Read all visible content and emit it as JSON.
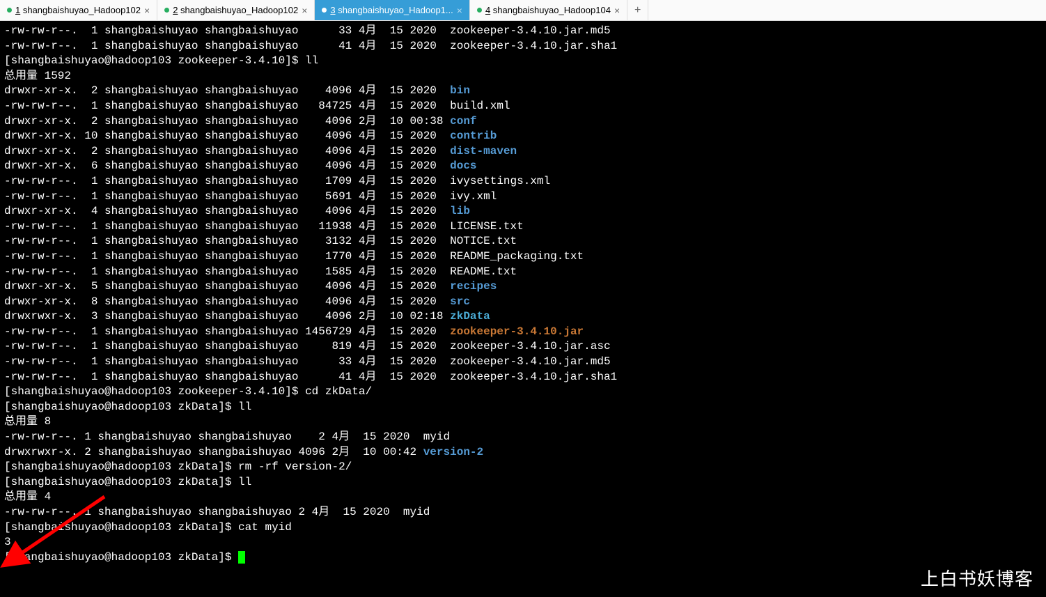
{
  "tabs": [
    {
      "num": "1",
      "label": " shangbaishuyao_Hadoop102",
      "close": "×",
      "active": false
    },
    {
      "num": "2",
      "label": " shangbaishuyao_Hadoop102",
      "close": "×",
      "active": false
    },
    {
      "num": "3",
      "label": " shangbaishuyao_Hadoop1...",
      "close": "×",
      "active": true
    },
    {
      "num": "4",
      "label": " shangbaishuyao_Hadoop104",
      "close": "×",
      "active": false
    }
  ],
  "tab_add": "+",
  "watermark": "上白书妖博客",
  "header_rows": [
    {
      "perm": "-rw-rw-r--.",
      "links": "1",
      "owner": "shangbaishuyao",
      "group": "shangbaishuyao",
      "size": "33",
      "month": "4月",
      "day": "15",
      "time": "2020",
      "name": "zookeeper-3.4.10.jar.md5"
    },
    {
      "perm": "-rw-rw-r--.",
      "links": "1",
      "owner": "shangbaishuyao",
      "group": "shangbaishuyao",
      "size": "41",
      "month": "4月",
      "day": "15",
      "time": "2020",
      "name": "zookeeper-3.4.10.jar.sha1"
    }
  ],
  "prompt1": {
    "text": "[shangbaishuyao@hadoop103 zookeeper-3.4.10]$ ",
    "cmd": "ll"
  },
  "total1": "总用量 1592",
  "ls1": [
    {
      "perm": "drwxr-xr-x.",
      "links": "2",
      "owner": "shangbaishuyao",
      "group": "shangbaishuyao",
      "size": "4096",
      "month": "4月",
      "day": "15",
      "time": "2020",
      "name": "bin",
      "cls": "dir"
    },
    {
      "perm": "-rw-rw-r--.",
      "links": "1",
      "owner": "shangbaishuyao",
      "group": "shangbaishuyao",
      "size": "84725",
      "month": "4月",
      "day": "15",
      "time": "2020",
      "name": "build.xml",
      "cls": ""
    },
    {
      "perm": "drwxr-xr-x.",
      "links": "2",
      "owner": "shangbaishuyao",
      "group": "shangbaishuyao",
      "size": "4096",
      "month": "2月",
      "day": "10",
      "time": "00:38",
      "name": "conf",
      "cls": "dir"
    },
    {
      "perm": "drwxr-xr-x.",
      "links": "10",
      "owner": "shangbaishuyao",
      "group": "shangbaishuyao",
      "size": "4096",
      "month": "4月",
      "day": "15",
      "time": "2020",
      "name": "contrib",
      "cls": "dir"
    },
    {
      "perm": "drwxr-xr-x.",
      "links": "2",
      "owner": "shangbaishuyao",
      "group": "shangbaishuyao",
      "size": "4096",
      "month": "4月",
      "day": "15",
      "time": "2020",
      "name": "dist-maven",
      "cls": "dir"
    },
    {
      "perm": "drwxr-xr-x.",
      "links": "6",
      "owner": "shangbaishuyao",
      "group": "shangbaishuyao",
      "size": "4096",
      "month": "4月",
      "day": "15",
      "time": "2020",
      "name": "docs",
      "cls": "dir"
    },
    {
      "perm": "-rw-rw-r--.",
      "links": "1",
      "owner": "shangbaishuyao",
      "group": "shangbaishuyao",
      "size": "1709",
      "month": "4月",
      "day": "15",
      "time": "2020",
      "name": "ivysettings.xml",
      "cls": ""
    },
    {
      "perm": "-rw-rw-r--.",
      "links": "1",
      "owner": "shangbaishuyao",
      "group": "shangbaishuyao",
      "size": "5691",
      "month": "4月",
      "day": "15",
      "time": "2020",
      "name": "ivy.xml",
      "cls": ""
    },
    {
      "perm": "drwxr-xr-x.",
      "links": "4",
      "owner": "shangbaishuyao",
      "group": "shangbaishuyao",
      "size": "4096",
      "month": "4月",
      "day": "15",
      "time": "2020",
      "name": "lib",
      "cls": "dir"
    },
    {
      "perm": "-rw-rw-r--.",
      "links": "1",
      "owner": "shangbaishuyao",
      "group": "shangbaishuyao",
      "size": "11938",
      "month": "4月",
      "day": "15",
      "time": "2020",
      "name": "LICENSE.txt",
      "cls": ""
    },
    {
      "perm": "-rw-rw-r--.",
      "links": "1",
      "owner": "shangbaishuyao",
      "group": "shangbaishuyao",
      "size": "3132",
      "month": "4月",
      "day": "15",
      "time": "2020",
      "name": "NOTICE.txt",
      "cls": ""
    },
    {
      "perm": "-rw-rw-r--.",
      "links": "1",
      "owner": "shangbaishuyao",
      "group": "shangbaishuyao",
      "size": "1770",
      "month": "4月",
      "day": "15",
      "time": "2020",
      "name": "README_packaging.txt",
      "cls": ""
    },
    {
      "perm": "-rw-rw-r--.",
      "links": "1",
      "owner": "shangbaishuyao",
      "group": "shangbaishuyao",
      "size": "1585",
      "month": "4月",
      "day": "15",
      "time": "2020",
      "name": "README.txt",
      "cls": ""
    },
    {
      "perm": "drwxr-xr-x.",
      "links": "5",
      "owner": "shangbaishuyao",
      "group": "shangbaishuyao",
      "size": "4096",
      "month": "4月",
      "day": "15",
      "time": "2020",
      "name": "recipes",
      "cls": "dir"
    },
    {
      "perm": "drwxr-xr-x.",
      "links": "8",
      "owner": "shangbaishuyao",
      "group": "shangbaishuyao",
      "size": "4096",
      "month": "4月",
      "day": "15",
      "time": "2020",
      "name": "src",
      "cls": "dir"
    },
    {
      "perm": "drwxrwxr-x.",
      "links": "3",
      "owner": "shangbaishuyao",
      "group": "shangbaishuyao",
      "size": "4096",
      "month": "2月",
      "day": "10",
      "time": "02:18",
      "name": "zkData",
      "cls": "zkdata"
    },
    {
      "perm": "-rw-rw-r--.",
      "links": "1",
      "owner": "shangbaishuyao",
      "group": "shangbaishuyao",
      "size": "1456729",
      "month": "4月",
      "day": "15",
      "time": "2020",
      "name": "zookeeper-3.4.10.jar",
      "cls": "jar"
    },
    {
      "perm": "-rw-rw-r--.",
      "links": "1",
      "owner": "shangbaishuyao",
      "group": "shangbaishuyao",
      "size": "819",
      "month": "4月",
      "day": "15",
      "time": "2020",
      "name": "zookeeper-3.4.10.jar.asc",
      "cls": ""
    },
    {
      "perm": "-rw-rw-r--.",
      "links": "1",
      "owner": "shangbaishuyao",
      "group": "shangbaishuyao",
      "size": "33",
      "month": "4月",
      "day": "15",
      "time": "2020",
      "name": "zookeeper-3.4.10.jar.md5",
      "cls": ""
    },
    {
      "perm": "-rw-rw-r--.",
      "links": "1",
      "owner": "shangbaishuyao",
      "group": "shangbaishuyao",
      "size": "41",
      "month": "4月",
      "day": "15",
      "time": "2020",
      "name": "zookeeper-3.4.10.jar.sha1",
      "cls": ""
    }
  ],
  "prompt2": {
    "text": "[shangbaishuyao@hadoop103 zookeeper-3.4.10]$ ",
    "cmd": "cd zkData/"
  },
  "prompt3": {
    "text": "[shangbaishuyao@hadoop103 zkData]$ ",
    "cmd": "ll"
  },
  "total2": "总用量 8",
  "ls2": [
    {
      "perm": "-rw-rw-r--.",
      "links": "1",
      "owner": "shangbaishuyao",
      "group": "shangbaishuyao",
      "size": "2",
      "month": "4月",
      "day": "15",
      "time": "2020",
      "name": "myid",
      "cls": ""
    },
    {
      "perm": "drwxrwxr-x.",
      "links": "2",
      "owner": "shangbaishuyao",
      "group": "shangbaishuyao",
      "size": "4096",
      "month": "2月",
      "day": "10",
      "time": "00:42",
      "name": "version-2",
      "cls": "dir"
    }
  ],
  "prompt4": {
    "text": "[shangbaishuyao@hadoop103 zkData]$ ",
    "cmd": "rm -rf version-2/"
  },
  "prompt5": {
    "text": "[shangbaishuyao@hadoop103 zkData]$ ",
    "cmd": "ll"
  },
  "total3": "总用量 4",
  "ls3": [
    {
      "perm": "-rw-rw-r--.",
      "links": "1",
      "owner": "shangbaishuyao",
      "group": "shangbaishuyao",
      "size": "2",
      "month": "4月",
      "day": "15",
      "time": "2020",
      "name": "myid",
      "cls": ""
    }
  ],
  "prompt6": {
    "text": "[shangbaishuyao@hadoop103 zkData]$ ",
    "cmd": "cat myid"
  },
  "cat_output": "3",
  "prompt7": {
    "text": "[shangbaishuyao@hadoop103 zkData]$ ",
    "cmd": ""
  }
}
